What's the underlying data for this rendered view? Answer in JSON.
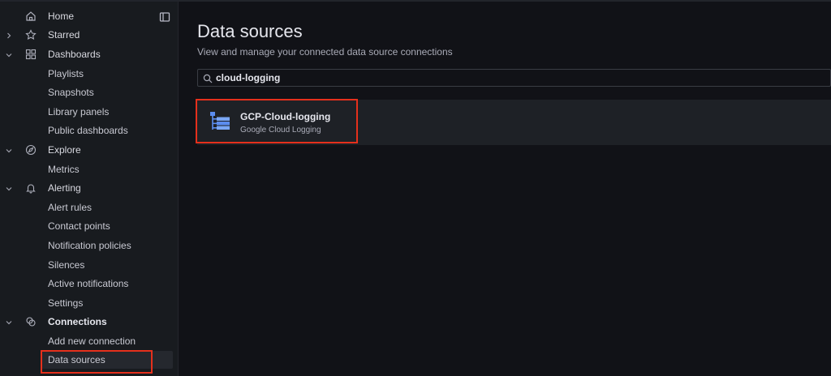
{
  "sidebar": {
    "items": [
      {
        "label": "Home",
        "icon": "home-icon",
        "chevron": "",
        "level": 0
      },
      {
        "label": "Starred",
        "icon": "star-icon",
        "chevron": "right",
        "level": 0
      },
      {
        "label": "Dashboards",
        "icon": "dashboards-grid-icon",
        "chevron": "down",
        "level": 0
      },
      {
        "label": "Playlists",
        "level": 1
      },
      {
        "label": "Snapshots",
        "level": 1
      },
      {
        "label": "Library panels",
        "level": 1
      },
      {
        "label": "Public dashboards",
        "level": 1
      },
      {
        "label": "Explore",
        "icon": "compass-icon",
        "chevron": "down",
        "level": 0
      },
      {
        "label": "Metrics",
        "level": 1
      },
      {
        "label": "Alerting",
        "icon": "bell-icon",
        "chevron": "down",
        "level": 0
      },
      {
        "label": "Alert rules",
        "level": 1
      },
      {
        "label": "Contact points",
        "level": 1
      },
      {
        "label": "Notification policies",
        "level": 1
      },
      {
        "label": "Silences",
        "level": 1
      },
      {
        "label": "Active notifications",
        "level": 1
      },
      {
        "label": "Settings",
        "level": 1
      },
      {
        "label": "Connections",
        "icon": "connections-icon",
        "chevron": "down",
        "level": 0,
        "bold": true
      },
      {
        "label": "Add new connection",
        "level": 1
      },
      {
        "label": "Data sources",
        "level": 1,
        "active": true
      }
    ]
  },
  "main": {
    "title": "Data sources",
    "subtitle": "View and manage your connected data source connections",
    "search": {
      "value": "cloud-logging"
    },
    "datasource": {
      "name": "GCP-Cloud-logging",
      "type": "Google Cloud Logging"
    }
  },
  "colors": {
    "highlight": "#e5301c",
    "icon_blue": "#5b8def"
  }
}
